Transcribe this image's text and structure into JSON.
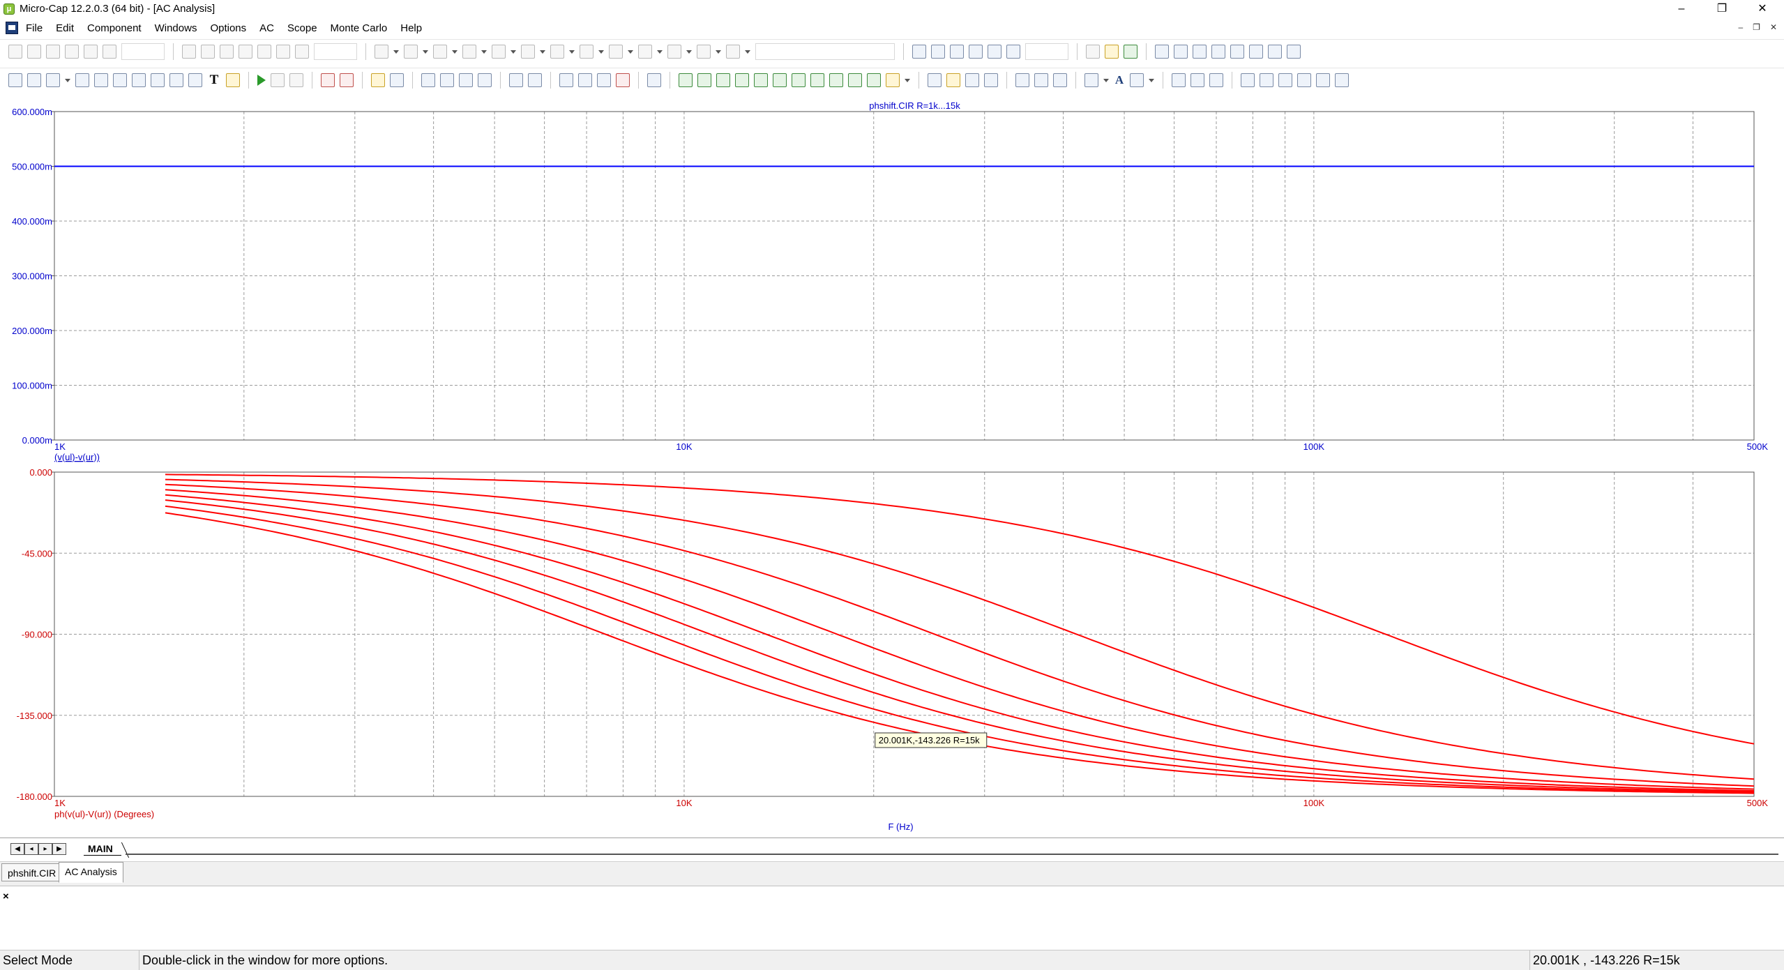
{
  "window": {
    "title": "Micro-Cap 12.2.0.3 (64 bit) - [AC Analysis]",
    "minimize": "–",
    "restore": "❐",
    "close": "✕"
  },
  "menu": {
    "items": [
      "File",
      "Edit",
      "Component",
      "Windows",
      "Options",
      "AC",
      "Scope",
      "Monte Carlo",
      "Help"
    ]
  },
  "plot": {
    "title": "phshift.CIR R=1k...15k",
    "top_ylabels": [
      "600.000m",
      "500.000m",
      "400.000m",
      "300.000m",
      "200.000m",
      "100.000m",
      "0.000m"
    ],
    "top_xlabels": [
      "1K",
      "10K",
      "100K",
      "500K"
    ],
    "top_expr": "(v(ul)-v(ur))",
    "bottom_ylabels": [
      "0.000",
      "-45.000",
      "-90.000",
      "-135.000",
      "-180.000"
    ],
    "bottom_xlabels": [
      "1K",
      "10K",
      "100K",
      "500K"
    ],
    "bottom_expr": "ph(v(ul)-V(ur)) (Degrees)",
    "x_axis_label": "F (Hz)",
    "cursor_label": "20.001K,-143.226 R=15k",
    "colors": {
      "top_trace": "#0000ff",
      "bottom_traces": "#ff0000",
      "axis_text_top": "#0000cc",
      "axis_text_bottom": "#cc0000",
      "grid": "#9a9a9a"
    }
  },
  "chart_data": [
    {
      "type": "line",
      "title": "phshift.CIR R=1k...15k",
      "xlabel": "F (Hz)",
      "ylabel": "(v(ul)-v(ur))",
      "x_scale": "log",
      "xlim": [
        1000,
        500000
      ],
      "ylim": [
        0,
        0.6
      ],
      "series": [
        {
          "x": [
            1000,
            500000
          ],
          "values": [
            0.5,
            0.5
          ]
        }
      ]
    },
    {
      "type": "line",
      "xlabel": "F (Hz)",
      "ylabel": "ph(v(ul)-V(ur)) (Degrees)",
      "x_scale": "log",
      "xlim": [
        1000,
        500000
      ],
      "ylim": [
        -180,
        0
      ],
      "x_start": 1500,
      "corner_frequencies": [
        130000,
        42000,
        25000,
        17500,
        13500,
        11000,
        9000,
        7500
      ],
      "series_formula": "phase = -2*atan(f/fc)",
      "cursor": {
        "x": 20001,
        "y": -143.226,
        "series": "R=15k"
      }
    }
  ],
  "sheet": {
    "tab": "MAIN"
  },
  "doc_tabs": [
    "phshift.CIR",
    "AC Analysis"
  ],
  "status": {
    "mode": "Select Mode",
    "hint": "Double-click in the window for more options.",
    "readout": "20.001K , -143.226 R=15k"
  }
}
